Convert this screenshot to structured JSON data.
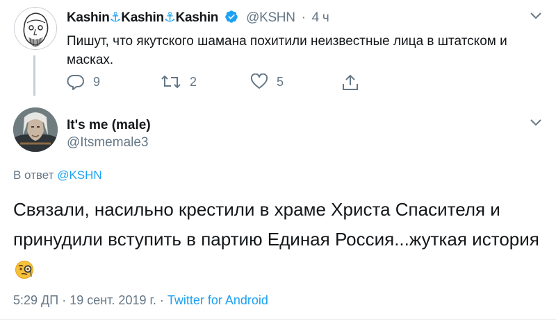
{
  "colors": {
    "accent": "#1da1f2",
    "muted": "#657786",
    "text": "#14171a"
  },
  "parent_tweet": {
    "author_name_parts": [
      "Kashin",
      "⚓",
      "Kashin",
      "⚓",
      "Kashin"
    ],
    "handle": "@KSHN",
    "time": "4 ч",
    "dot": "·",
    "text": "Пишут, что якутского шамана похитили неизвестные лица в штатском и масках.",
    "replies": "9",
    "retweets": "2",
    "likes": "5",
    "icons": [
      "reply-icon",
      "retweet-icon",
      "like-icon",
      "share-icon",
      "verified-badge-icon",
      "chevron-down-icon"
    ]
  },
  "reply_tweet": {
    "author_name": "It's me (male)",
    "handle": "@Itsmemale3",
    "reply_to_prefix": "В ответ",
    "reply_to_handle": "@KSHN",
    "text": "Связали, насильно крестили в храме Христа Спасителя  и принудили вступить в партию Единая Россия...жуткая история",
    "time": "5:29 ДП",
    "dot": "·",
    "date": "19 сент. 2019 г.",
    "source": "Twitter for Android",
    "emoji": "face-with-monocle-emoji"
  }
}
